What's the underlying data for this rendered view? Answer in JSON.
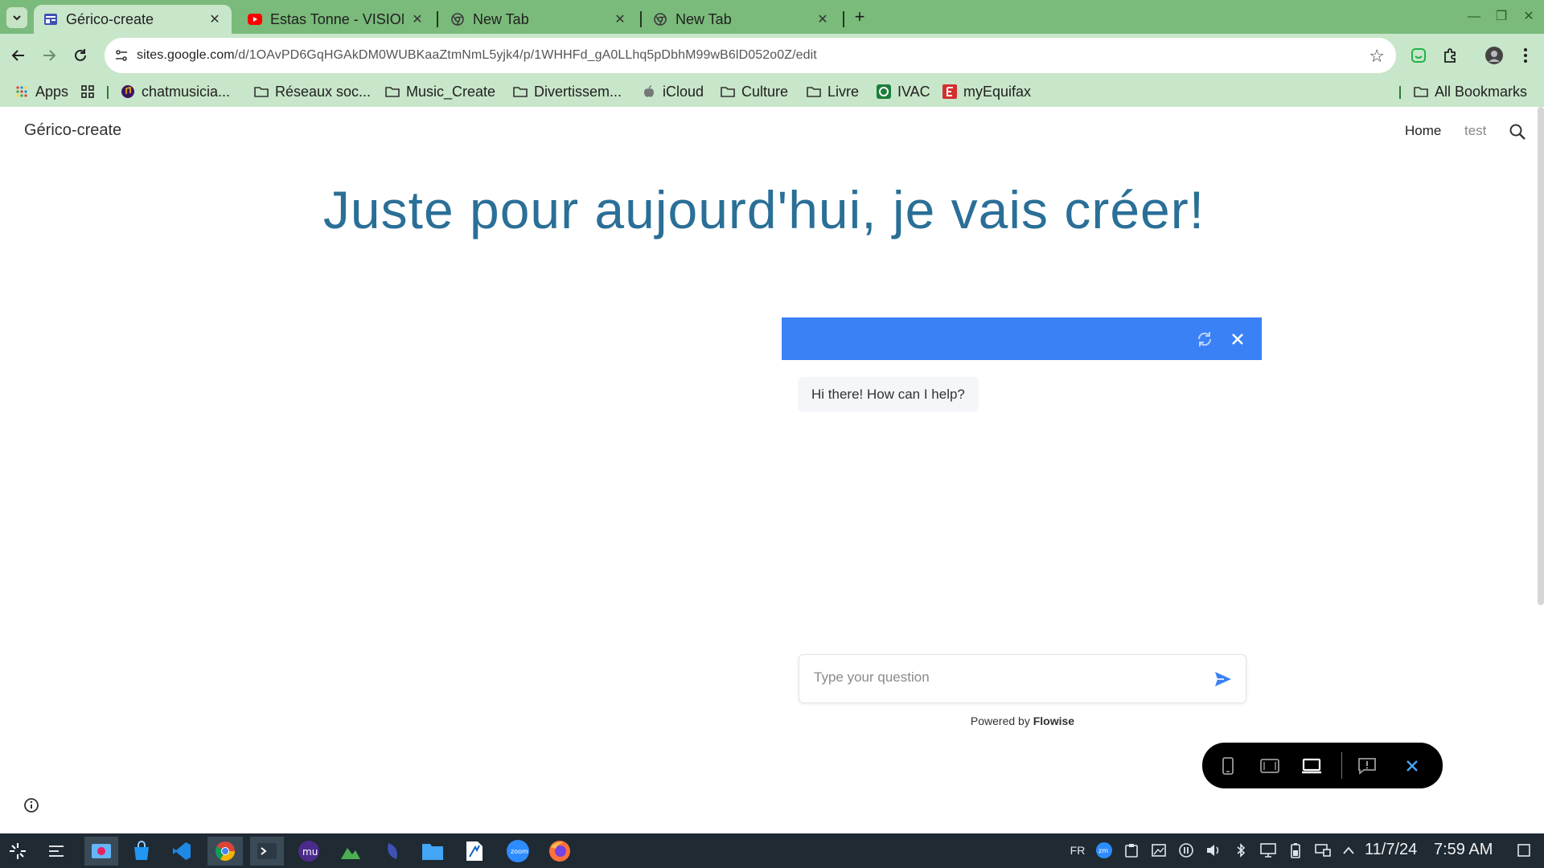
{
  "browser": {
    "tabs": [
      {
        "title": "Gérico-create",
        "active": true,
        "icon": "google-sites-icon"
      },
      {
        "title": "Estas Tonne - VISION",
        "active": false,
        "icon": "youtube-icon"
      },
      {
        "title": "New Tab",
        "active": false,
        "icon": "chrome-icon"
      },
      {
        "title": "New Tab",
        "active": false,
        "icon": "chrome-icon"
      }
    ],
    "new_tab_label": "+",
    "url_host": "sites.google.com",
    "url_path": "/d/1OAvPD6GqHGAkDM0WUBKaaZtmNmL5yjk4/p/1WHHFd_gA0LLhq5pDbhM99wB6lD052o0Z/edit",
    "bookmarks": [
      {
        "label": "Apps",
        "icon": "apps-grid-icon"
      },
      {
        "label": "chatmusicia...",
        "icon": "chatmusician-icon"
      },
      {
        "label": "Réseaux soc...",
        "icon": "folder-icon"
      },
      {
        "label": "Music_Create",
        "icon": "folder-icon"
      },
      {
        "label": "Divertissem...",
        "icon": "folder-icon"
      },
      {
        "label": "iCloud",
        "icon": "apple-icon"
      },
      {
        "label": "Culture",
        "icon": "folder-icon"
      },
      {
        "label": "Livre",
        "icon": "folder-icon"
      },
      {
        "label": "IVAC",
        "icon": "ivac-icon"
      },
      {
        "label": "myEquifax",
        "icon": "equifax-icon"
      }
    ],
    "all_bookmarks": "All Bookmarks",
    "colors": {
      "tabstrip": "#7aba7b",
      "toolbar": "#c8e6c9"
    }
  },
  "site": {
    "title": "Gérico-create",
    "nav": [
      {
        "label": "Home",
        "active": true
      },
      {
        "label": "test",
        "active": false
      }
    ],
    "hero": "Juste pour aujourd'hui, je vais créer!"
  },
  "chat": {
    "welcome": "Hi there! How can I help?",
    "placeholder": "Type your question",
    "powered_prefix": "Powered by",
    "powered_brand": "Flowise",
    "header_color": "#3b81f6"
  },
  "taskbar": {
    "lang": "FR",
    "date": "11/7/24",
    "time": "7:59 AM"
  }
}
